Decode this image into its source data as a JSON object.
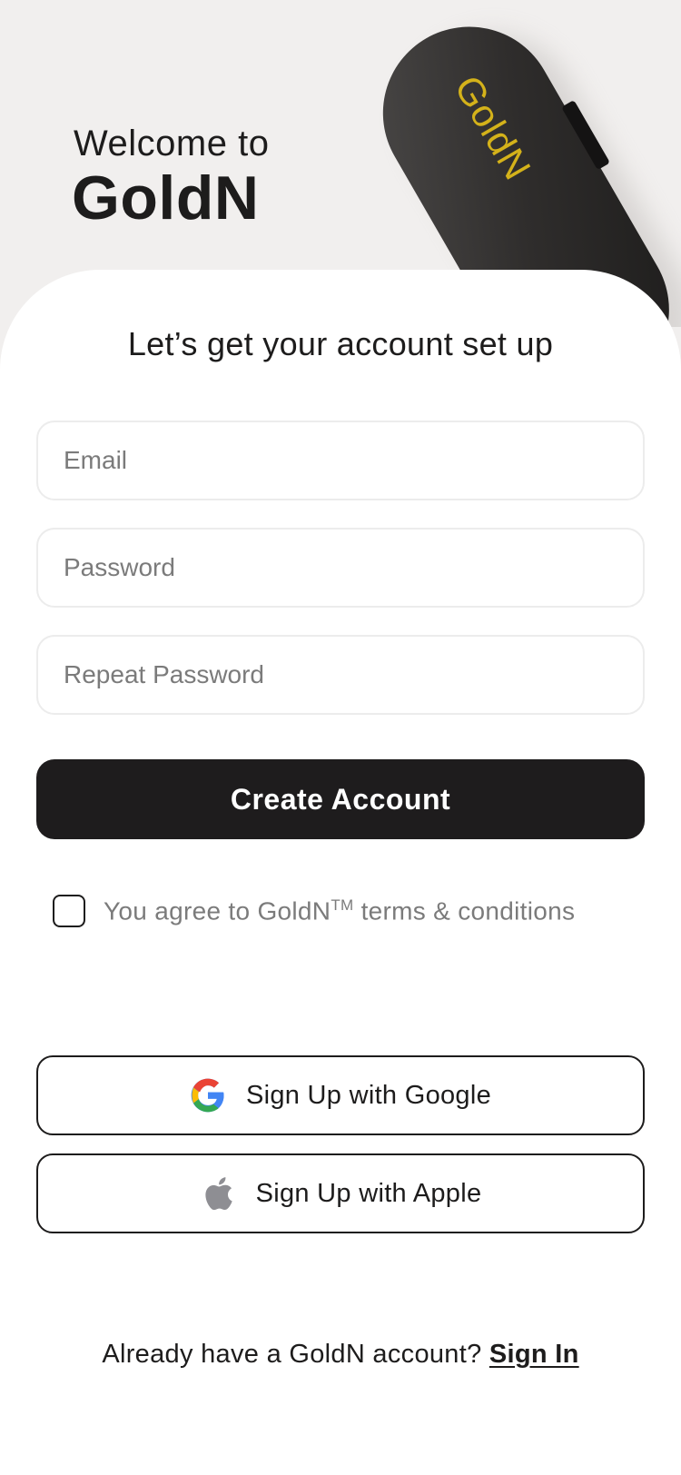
{
  "hero": {
    "welcome": "Welcome to",
    "brand": "GoldN",
    "device_logo": "GoldN"
  },
  "form": {
    "subtitle": "Let’s get your account set up",
    "email_placeholder": "Email",
    "password_placeholder": "Password",
    "repeat_password_placeholder": "Repeat Password",
    "create_label": "Create Account",
    "terms_prefix": "You agree to GoldN",
    "terms_tm": "TM",
    "terms_suffix": " terms & conditions",
    "terms_checked": false
  },
  "social": {
    "google_label": "Sign Up with Google",
    "apple_label": "Sign Up with Apple",
    "google_icon": "google-icon",
    "apple_icon": "apple-icon"
  },
  "footer": {
    "prompt": "Already have a GoldN account? ",
    "signin_label": "Sign In"
  },
  "colors": {
    "background": "#f1efee",
    "card": "#ffffff",
    "primary": "#1e1c1d",
    "muted_text": "#7b7b7b",
    "device_logo": "#d4b21a"
  }
}
